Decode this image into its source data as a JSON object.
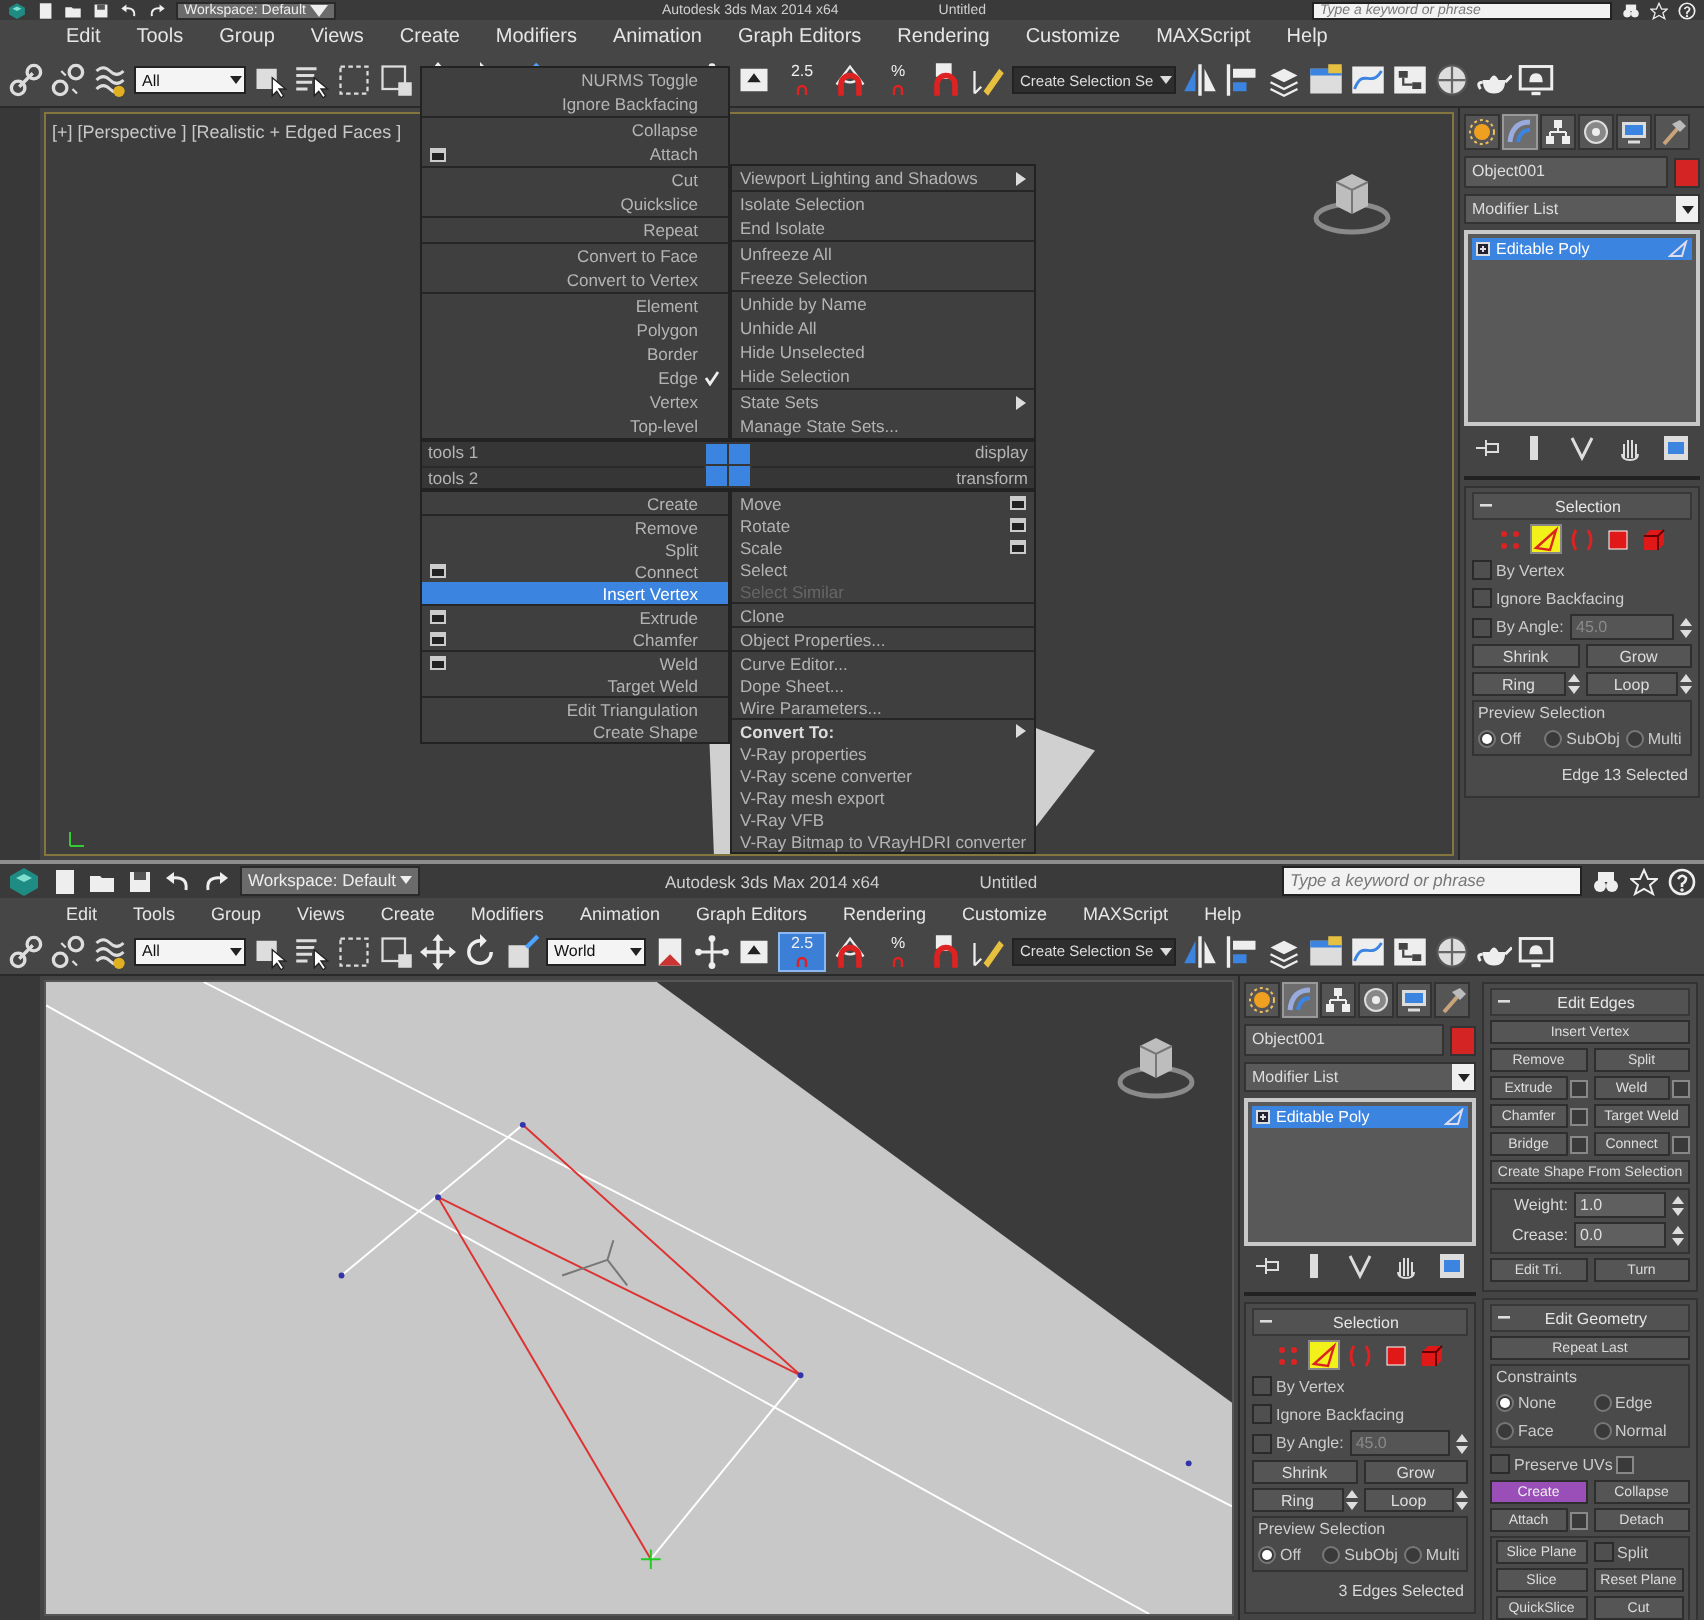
{
  "screens": [
    {
      "title_bar": {
        "workspace": "Workspace: Default",
        "app_title": "Autodesk 3ds Max  2014 x64",
        "document": "Untitled",
        "search": {
          "placeholder": "Type a keyword or phrase"
        }
      },
      "menu_bar": [
        "Edit",
        "Tools",
        "Group",
        "Views",
        "Create",
        "Modifiers",
        "Animation",
        "Graph Editors",
        "Rendering",
        "Customize",
        "MAXScript",
        "Help"
      ],
      "toolbar": {
        "selection_filter": "All",
        "snap_label": "2.5",
        "snap_active": false,
        "percent_label": "%",
        "named_selection": "Create Selection Se"
      },
      "viewport": {
        "kind": "dark",
        "label": "[+] [Perspective ] [Realistic + Edged Faces ]"
      },
      "quad_menu": {
        "quadrants": [
          {
            "label": "tools 1",
            "groups": [
              [
                {
                  "label": "NURMS Toggle",
                  "selected": false,
                  "checked": false,
                  "disabled": false
                },
                {
                  "label": "Ignore Backfacing",
                  "selected": false,
                  "checked": false,
                  "disabled": false
                }
              ],
              [
                {
                  "label": "Collapse",
                  "selected": false,
                  "checked": false,
                  "disabled": false
                },
                {
                  "label": "Attach",
                  "options": true,
                  "selected": false,
                  "checked": false,
                  "disabled": false
                }
              ],
              [
                {
                  "label": "Cut",
                  "selected": false,
                  "checked": false,
                  "disabled": false
                },
                {
                  "label": "Quickslice",
                  "selected": false,
                  "checked": false,
                  "disabled": false
                }
              ],
              [
                {
                  "label": "Repeat",
                  "selected": false,
                  "checked": false,
                  "disabled": false
                }
              ],
              [
                {
                  "label": "Convert to Face",
                  "selected": false,
                  "checked": false,
                  "disabled": false
                },
                {
                  "label": "Convert to Vertex",
                  "selected": false,
                  "checked": false,
                  "disabled": false
                }
              ],
              [
                {
                  "label": "Element",
                  "selected": false,
                  "checked": false,
                  "disabled": false
                },
                {
                  "label": "Polygon",
                  "selected": false,
                  "checked": false,
                  "disabled": false
                },
                {
                  "label": "Border",
                  "selected": false,
                  "checked": false,
                  "disabled": false
                },
                {
                  "label": "Edge",
                  "selected": false,
                  "checked": true,
                  "disabled": false
                },
                {
                  "label": "Vertex",
                  "selected": false,
                  "checked": false,
                  "disabled": false
                },
                {
                  "label": "Top-level",
                  "selected": false,
                  "checked": false,
                  "disabled": false
                }
              ]
            ]
          },
          {
            "label": "display",
            "groups": [
              [
                {
                  "label": "Viewport Lighting and Shadows",
                  "submenu": true,
                  "selected": false,
                  "checked": false,
                  "disabled": false
                }
              ],
              [
                {
                  "label": "Isolate Selection",
                  "selected": false,
                  "checked": false,
                  "disabled": false
                },
                {
                  "label": "End Isolate",
                  "selected": false,
                  "checked": false,
                  "disabled": false
                }
              ],
              [
                {
                  "label": "Unfreeze All",
                  "selected": false,
                  "checked": false,
                  "disabled": false
                },
                {
                  "label": "Freeze Selection",
                  "selected": false,
                  "checked": false,
                  "disabled": false
                }
              ],
              [
                {
                  "label": "Unhide by Name",
                  "selected": false,
                  "checked": false,
                  "disabled": false
                },
                {
                  "label": "Unhide All",
                  "selected": false,
                  "checked": false,
                  "disabled": false
                },
                {
                  "label": "Hide Unselected",
                  "selected": false,
                  "checked": false,
                  "disabled": false
                },
                {
                  "label": "Hide Selection",
                  "selected": false,
                  "checked": false,
                  "disabled": false
                }
              ],
              [
                {
                  "label": "State Sets",
                  "submenu": true,
                  "selected": false,
                  "checked": false,
                  "disabled": false
                },
                {
                  "label": "Manage State Sets...",
                  "selected": false,
                  "checked": false,
                  "disabled": false
                }
              ]
            ]
          },
          {
            "label": "tools 2",
            "groups": [
              [
                {
                  "label": "Create",
                  "selected": false,
                  "checked": false,
                  "disabled": false
                }
              ],
              [
                {
                  "label": "Remove",
                  "selected": false,
                  "checked": false,
                  "disabled": false
                },
                {
                  "label": "Split",
                  "selected": false,
                  "checked": false,
                  "disabled": false
                },
                {
                  "label": "Connect",
                  "options": true,
                  "selected": false,
                  "checked": false,
                  "disabled": false
                },
                {
                  "label": "Insert Vertex",
                  "selected": true,
                  "checked": false,
                  "disabled": false
                }
              ],
              [
                {
                  "label": "Extrude",
                  "options": true,
                  "selected": false,
                  "checked": false,
                  "disabled": false
                },
                {
                  "label": "Chamfer",
                  "options": true,
                  "selected": false,
                  "checked": false,
                  "disabled": false
                }
              ],
              [
                {
                  "label": "Weld",
                  "options": true,
                  "selected": false,
                  "checked": false,
                  "disabled": false
                },
                {
                  "label": "Target Weld",
                  "selected": false,
                  "checked": false,
                  "disabled": false
                }
              ],
              [
                {
                  "label": "Edit Triangulation",
                  "selected": false,
                  "checked": false,
                  "disabled": false
                },
                {
                  "label": "Create Shape",
                  "selected": false,
                  "checked": false,
                  "disabled": false
                }
              ]
            ]
          },
          {
            "label": "transform",
            "groups": [
              [
                {
                  "label": "Move",
                  "options": true,
                  "selected": false,
                  "checked": false,
                  "disabled": false
                },
                {
                  "label": "Rotate",
                  "options": true,
                  "selected": false,
                  "checked": false,
                  "disabled": false
                },
                {
                  "label": "Scale",
                  "options": true,
                  "selected": false,
                  "checked": false,
                  "disabled": false
                },
                {
                  "label": "Select",
                  "selected": false,
                  "checked": false,
                  "disabled": false
                },
                {
                  "label": "Select Similar",
                  "selected": false,
                  "checked": false,
                  "disabled": true
                }
              ],
              [
                {
                  "label": "Clone",
                  "selected": false,
                  "checked": false,
                  "disabled": false
                }
              ],
              [
                {
                  "label": "Object Properties...",
                  "selected": false,
                  "checked": false,
                  "disabled": false
                }
              ],
              [
                {
                  "label": "Curve Editor...",
                  "selected": false,
                  "checked": false,
                  "disabled": false
                },
                {
                  "label": "Dope Sheet...",
                  "selected": false,
                  "checked": false,
                  "disabled": false
                },
                {
                  "label": "Wire Parameters...",
                  "selected": false,
                  "checked": false,
                  "disabled": false
                }
              ],
              [
                {
                  "label": "Convert To:",
                  "bold": true,
                  "submenu": true,
                  "selected": false,
                  "checked": false,
                  "disabled": false
                },
                {
                  "label": "V-Ray properties",
                  "selected": false,
                  "checked": false,
                  "disabled": false
                },
                {
                  "label": "V-Ray scene converter",
                  "selected": false,
                  "checked": false,
                  "disabled": false
                },
                {
                  "label": "V-Ray mesh export",
                  "selected": false,
                  "checked": false,
                  "disabled": false
                },
                {
                  "label": "V-Ray VFB",
                  "selected": false,
                  "checked": false,
                  "disabled": false
                },
                {
                  "label": "V-Ray Bitmap to VRayHDRI converter",
                  "selected": false,
                  "checked": false,
                  "disabled": false
                }
              ]
            ]
          }
        ]
      },
      "command_panel": {
        "tabs": [
          {
            "selected": false
          },
          {
            "selected": true
          },
          {
            "selected": false
          },
          {
            "selected": false
          },
          {
            "selected": false
          },
          {
            "selected": false
          }
        ],
        "object_name": "Object001",
        "modifier_list": "Modifier List",
        "stack": [
          {
            "label": "Editable Poly",
            "selected": true
          }
        ],
        "rollouts": [
          {
            "title": "Selection",
            "sections": [
              {
                "kind": "plain",
                "rows": [
                  [
                    {
                      "kind": "subobjects",
                      "levels": [
                        {
                          "selected": false
                        },
                        {
                          "selected": true
                        },
                        {
                          "selected": false
                        },
                        {
                          "selected": false
                        },
                        {
                          "selected": false
                        }
                      ]
                    }
                  ],
                  [
                    {
                      "kind": "checkbox",
                      "label": "By Vertex",
                      "checked": false
                    }
                  ],
                  [
                    {
                      "kind": "checkbox",
                      "label": "Ignore Backfacing",
                      "checked": false
                    }
                  ],
                  [
                    {
                      "kind": "checkbox",
                      "label": "By Angle:",
                      "checked": false
                    },
                    {
                      "kind": "field",
                      "value": "45.0",
                      "disabled": true
                    }
                  ],
                  [
                    {
                      "kind": "button",
                      "label": "Shrink"
                    },
                    {
                      "kind": "button",
                      "label": "Grow"
                    }
                  ],
                  [
                    {
                      "kind": "button",
                      "label": "Ring",
                      "spinner": true
                    },
                    {
                      "kind": "button",
                      "label": "Loop",
                      "spinner": true
                    }
                  ]
                ]
              },
              {
                "kind": "group",
                "title": "Preview Selection",
                "rows": [
                  [
                    {
                      "kind": "radio",
                      "label": "Off",
                      "selected": true
                    },
                    {
                      "kind": "radio",
                      "label": "SubObj",
                      "selected": false
                    },
                    {
                      "kind": "radio",
                      "label": "Multi",
                      "selected": false
                    }
                  ]
                ]
              },
              {
                "kind": "plain",
                "rows": [
                  [
                    {
                      "kind": "text",
                      "label": "Edge 13 Selected"
                    }
                  ]
                ]
              }
            ]
          }
        ]
      }
    },
    {
      "title_bar": {
        "workspace": "Workspace: Default",
        "app_title": "Autodesk 3ds Max  2014 x64",
        "document": "Untitled",
        "search": {
          "placeholder": "Type a keyword or phrase"
        }
      },
      "menu_bar": [
        "Edit",
        "Tools",
        "Group",
        "Views",
        "Create",
        "Modifiers",
        "Animation",
        "Graph Editors",
        "Rendering",
        "Customize",
        "MAXScript",
        "Help"
      ],
      "toolbar": {
        "selection_filter": "All",
        "coordinate_system": "World",
        "snap_label": "2.5",
        "snap_active": true,
        "percent_label": "%",
        "named_selection": "Create Selection Se"
      },
      "viewport": {
        "kind": "light"
      },
      "command_panel": {
        "tabs": [
          {
            "selected": false
          },
          {
            "selected": true
          },
          {
            "selected": false
          },
          {
            "selected": false
          },
          {
            "selected": false
          },
          {
            "selected": false
          }
        ],
        "object_name": "Object001",
        "modifier_list": "Modifier List",
        "stack": [
          {
            "label": "Editable Poly",
            "selected": true
          }
        ],
        "rollouts": [
          {
            "title": "Selection",
            "sections": [
              {
                "kind": "plain",
                "rows": [
                  [
                    {
                      "kind": "subobjects",
                      "levels": [
                        {
                          "selected": false
                        },
                        {
                          "selected": true
                        },
                        {
                          "selected": false
                        },
                        {
                          "selected": false
                        },
                        {
                          "selected": false
                        }
                      ]
                    }
                  ],
                  [
                    {
                      "kind": "checkbox",
                      "label": "By Vertex",
                      "checked": false
                    }
                  ],
                  [
                    {
                      "kind": "checkbox",
                      "label": "Ignore Backfacing",
                      "checked": false
                    }
                  ],
                  [
                    {
                      "kind": "checkbox",
                      "label": "By Angle:",
                      "checked": false
                    },
                    {
                      "kind": "field",
                      "value": "45.0",
                      "disabled": true
                    }
                  ],
                  [
                    {
                      "kind": "button",
                      "label": "Shrink"
                    },
                    {
                      "kind": "button",
                      "label": "Grow"
                    }
                  ],
                  [
                    {
                      "kind": "button",
                      "label": "Ring",
                      "spinner": true
                    },
                    {
                      "kind": "button",
                      "label": "Loop",
                      "spinner": true
                    }
                  ]
                ]
              },
              {
                "kind": "group",
                "title": "Preview Selection",
                "rows": [
                  [
                    {
                      "kind": "radio",
                      "label": "Off",
                      "selected": true
                    },
                    {
                      "kind": "radio",
                      "label": "SubObj",
                      "selected": false
                    },
                    {
                      "kind": "radio",
                      "label": "Multi",
                      "selected": false
                    }
                  ]
                ]
              },
              {
                "kind": "plain",
                "rows": [
                  [
                    {
                      "kind": "text",
                      "label": "3 Edges Selected"
                    }
                  ]
                ]
              }
            ]
          }
        ],
        "side_rollouts": [
          {
            "title": "Edit Edges",
            "sections": [
              {
                "kind": "plain",
                "rows": [
                  [
                    {
                      "kind": "button",
                      "label": "Insert Vertex"
                    }
                  ],
                  [
                    {
                      "kind": "button",
                      "label": "Remove"
                    },
                    {
                      "kind": "button",
                      "label": "Split"
                    }
                  ],
                  [
                    {
                      "kind": "button",
                      "label": "Extrude",
                      "options": true
                    },
                    {
                      "kind": "button",
                      "label": "Weld",
                      "options": true
                    }
                  ],
                  [
                    {
                      "kind": "button",
                      "label": "Chamfer",
                      "options": true
                    },
                    {
                      "kind": "button",
                      "label": "Target Weld"
                    }
                  ],
                  [
                    {
                      "kind": "button",
                      "label": "Bridge",
                      "options": true
                    },
                    {
                      "kind": "button",
                      "label": "Connect",
                      "options": true
                    }
                  ],
                  [
                    {
                      "kind": "button",
                      "label": "Create Shape From Selection"
                    }
                  ]
                ]
              },
              {
                "kind": "group",
                "rows": [
                  [
                    {
                      "kind": "field",
                      "label": "Weight:",
                      "value": "1.0"
                    }
                  ],
                  [
                    {
                      "kind": "field",
                      "label": "Crease:",
                      "value": "0.0"
                    }
                  ]
                ]
              },
              {
                "kind": "plain",
                "rows": [
                  [
                    {
                      "kind": "button",
                      "label": "Edit Tri."
                    },
                    {
                      "kind": "button",
                      "label": "Turn"
                    }
                  ]
                ]
              }
            ]
          },
          {
            "title": "Edit Geometry",
            "sections": [
              {
                "kind": "plain",
                "rows": [
                  [
                    {
                      "kind": "button",
                      "label": "Repeat Last"
                    }
                  ]
                ]
              },
              {
                "kind": "group",
                "title": "Constraints",
                "rows": [
                  [
                    {
                      "kind": "radio",
                      "label": "None",
                      "selected": true
                    },
                    {
                      "kind": "radio",
                      "label": "Edge",
                      "selected": false
                    }
                  ],
                  [
                    {
                      "kind": "radio",
                      "label": "Face",
                      "selected": false
                    },
                    {
                      "kind": "radio",
                      "label": "Normal",
                      "selected": false
                    }
                  ]
                ]
              },
              {
                "kind": "plain",
                "rows": [
                  [
                    {
                      "kind": "checkbox",
                      "label": "Preserve UVs",
                      "checked": false,
                      "options": true
                    }
                  ],
                  [
                    {
                      "kind": "toggle",
                      "label": "Create",
                      "on": true
                    },
                    {
                      "kind": "button",
                      "label": "Collapse"
                    }
                  ],
                  [
                    {
                      "kind": "button",
                      "label": "Attach",
                      "options": true
                    },
                    {
                      "kind": "button",
                      "label": "Detach"
                    }
                  ]
                ]
              },
              {
                "kind": "group",
                "rows": [
                  [
                    {
                      "kind": "button",
                      "label": "Slice Plane"
                    },
                    {
                      "kind": "checkbox",
                      "label": "Split",
                      "checked": false
                    }
                  ],
                  [
                    {
                      "kind": "button",
                      "label": "Slice"
                    },
                    {
                      "kind": "button",
                      "label": "Reset Plane"
                    }
                  ],
                  [
                    {
                      "kind": "button",
                      "label": "QuickSlice"
                    },
                    {
                      "kind": "button",
                      "label": "Cut"
                    }
                  ]
                ]
              }
            ]
          }
        ]
      }
    }
  ]
}
